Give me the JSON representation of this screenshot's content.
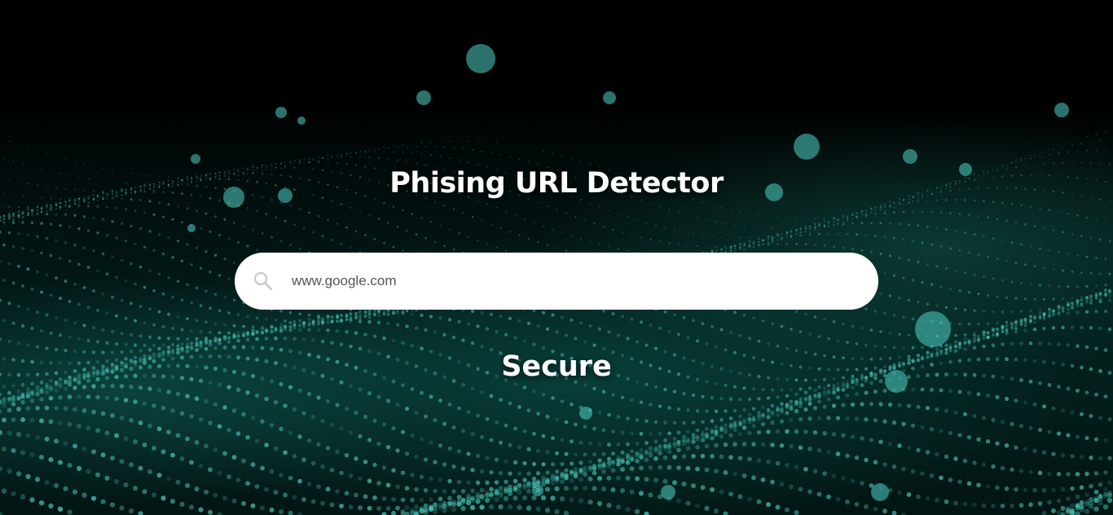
{
  "page": {
    "title": "Phising URL Detector",
    "result": "Secure"
  },
  "search": {
    "value": "www.google.com",
    "icon": "search-icon"
  },
  "colors": {
    "particle": "#4fd1c5",
    "background": "#000000",
    "search_bg": "#ffffff"
  }
}
